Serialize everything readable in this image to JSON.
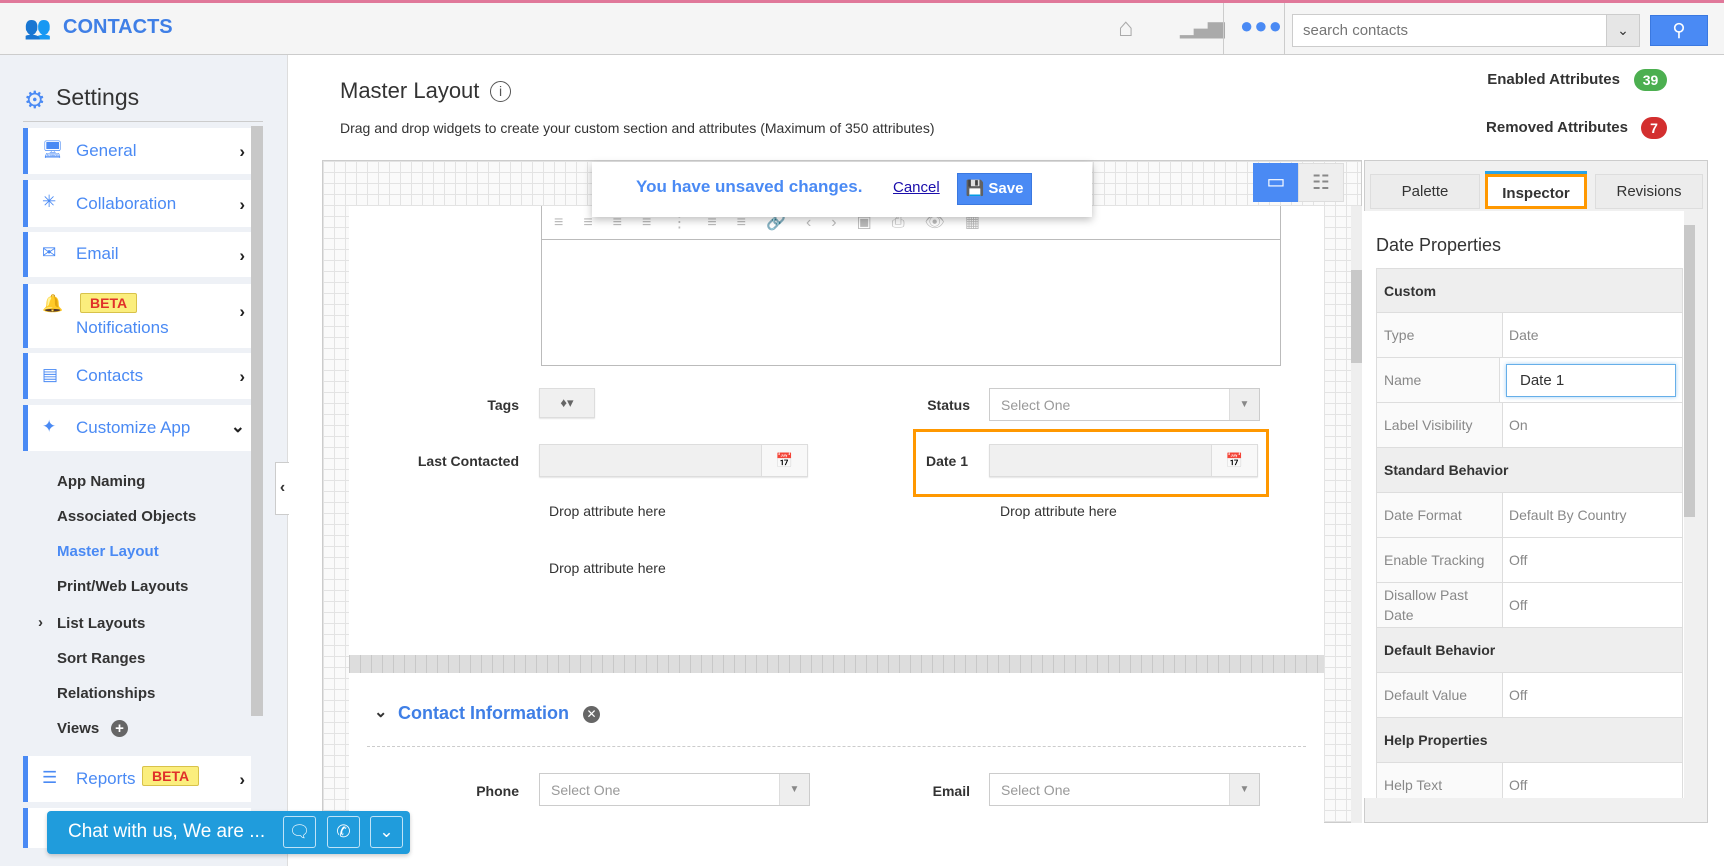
{
  "app": {
    "title": "CONTACTS",
    "icon": "contacts-people-icon"
  },
  "topbar": {
    "home_icon": "home-icon",
    "chart_icon": "bar-chart-icon",
    "more_icon": "more-dots-icon",
    "search_placeholder": "search contacts",
    "search_icon": "search-icon"
  },
  "sidebar": {
    "heading": "Settings",
    "items": [
      {
        "label": "General",
        "icon": "monitor-icon"
      },
      {
        "label": "Collaboration",
        "icon": "network-icon"
      },
      {
        "label": "Email",
        "icon": "envelope-icon"
      },
      {
        "label": "Notifications",
        "icon": "bell-icon",
        "badge": "BETA"
      },
      {
        "label": "Contacts",
        "icon": "contact-card-icon"
      },
      {
        "label": "Customize App",
        "icon": "tools-icon",
        "expanded": true
      },
      {
        "label": "Reports",
        "icon": "report-icon",
        "badge": "BETA"
      }
    ],
    "subitems": [
      {
        "label": "App Naming"
      },
      {
        "label": "Associated Objects"
      },
      {
        "label": "Master Layout",
        "active": true
      },
      {
        "label": "Print/Web Layouts"
      },
      {
        "label": "List Layouts"
      },
      {
        "label": "Sort Ranges"
      },
      {
        "label": "Relationships"
      },
      {
        "label": "Views"
      }
    ]
  },
  "main": {
    "title": "Master Layout",
    "description": "Drag and drop widgets to create your custom section and attributes (Maximum of 350 attributes)",
    "enabled_label": "Enabled Attributes",
    "enabled_count": "39",
    "removed_label": "Removed Attributes",
    "removed_count": "7",
    "unsaved": {
      "message": "You have unsaved changes.",
      "cancel": "Cancel",
      "save": "Save"
    },
    "form": {
      "tags": "Tags",
      "status": "Status",
      "status_value": "Select One",
      "last_contacted": "Last Contacted",
      "date1": "Date 1",
      "drop": "Drop attribute here",
      "section": "Contact Information",
      "phone": "Phone",
      "phone_value": "Select One",
      "email": "Email",
      "email_value": "Select One"
    }
  },
  "panel": {
    "tabs": [
      "Palette",
      "Inspector",
      "Revisions"
    ],
    "active_tab": "Inspector",
    "title": "Date Properties",
    "rows": [
      {
        "h": "Custom"
      },
      {
        "k": "Type",
        "v": "Date"
      },
      {
        "k": "Name",
        "input": "Date 1"
      },
      {
        "k": "Label Visibility",
        "v": "On"
      },
      {
        "h": "Standard Behavior"
      },
      {
        "k": "Date Format",
        "v": "Default By Country"
      },
      {
        "k": "Enable Tracking",
        "v": "Off"
      },
      {
        "k": "Disallow Past Date",
        "v": "Off"
      },
      {
        "h": "Default Behavior"
      },
      {
        "k": "Default Value",
        "v": "Off"
      },
      {
        "h": "Help Properties"
      },
      {
        "k": "Help Text",
        "v": "Off"
      }
    ]
  },
  "chat": {
    "text": "Chat with us, We are ..."
  },
  "colors": {
    "accent": "#4a8af4",
    "highlight": "#ff9800",
    "enabled": "#4caf50",
    "removed": "#d32f2f",
    "chat": "#209cdc",
    "beta_bg": "#fbee7d"
  }
}
